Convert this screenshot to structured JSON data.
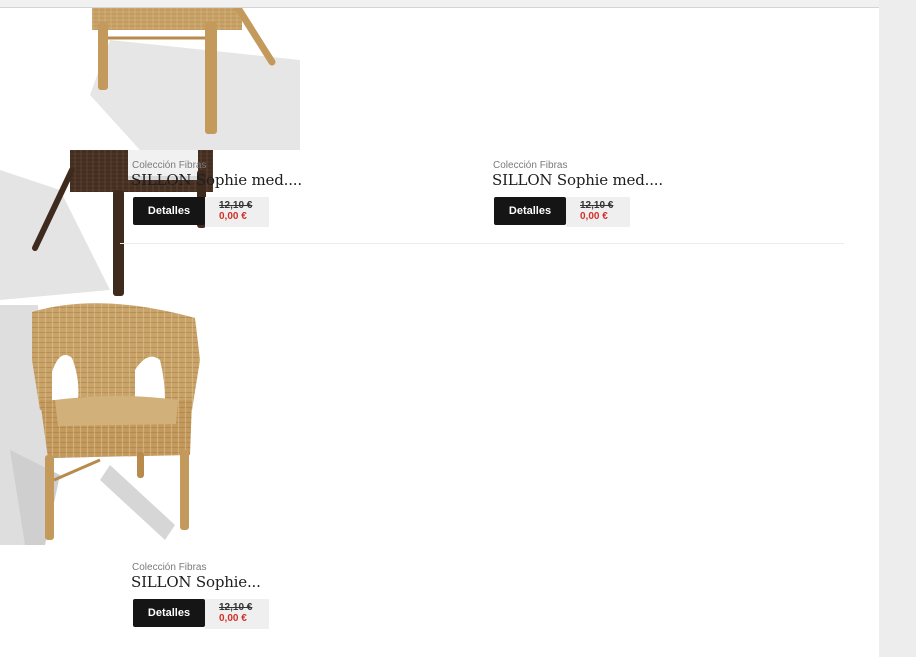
{
  "products": [
    {
      "collection": "Colección Fibras",
      "title": "SILLON Sophie med....",
      "button": "Detalles",
      "price_old": "12,10 €",
      "price_new": "0,00 €"
    },
    {
      "collection": "Colección Fibras",
      "title": "SILLON Sophie med....",
      "button": "Detalles",
      "price_old": "12,10 €",
      "price_new": "0,00 €"
    },
    {
      "collection": "Colección Fibras",
      "title": "SILLON Sophie...",
      "button": "Detalles",
      "price_old": "12,10 €",
      "price_new": "0,00 €"
    }
  ],
  "colors": {
    "button_bg": "#151515",
    "price_new": "#d0302a",
    "price_box_bg": "#efefef",
    "natural_rattan": "#c9a46a",
    "dark_rattan": "#4a3325"
  },
  "icons": [
    "product-image-natural-chair",
    "product-image-dark-chair",
    "product-image-natural-chair"
  ]
}
